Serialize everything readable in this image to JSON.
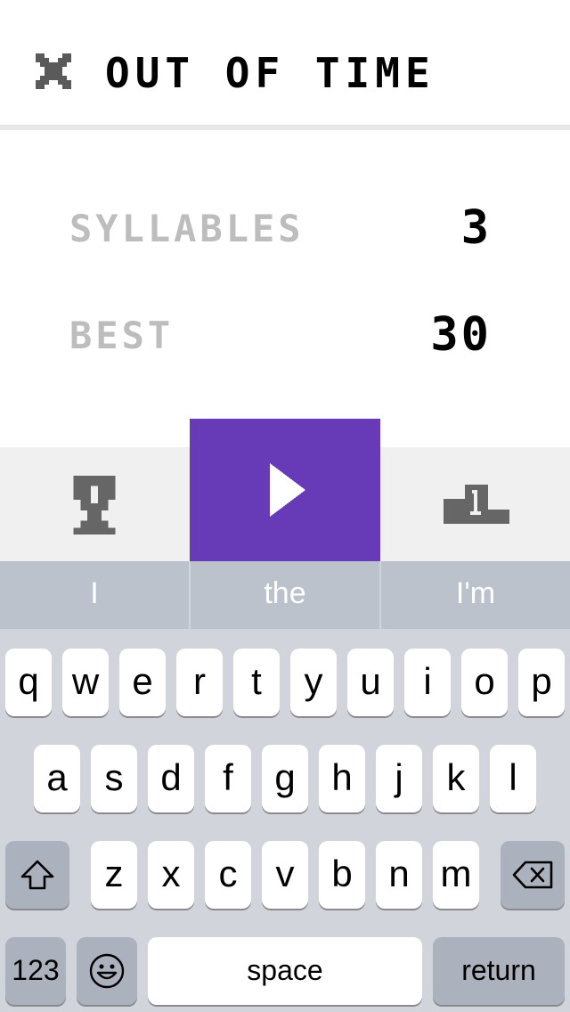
{
  "header": {
    "title": "OUT OF TIME"
  },
  "stats": {
    "syllables_label": "SYLLABLES",
    "syllables_value": "3",
    "best_label": "BEST",
    "best_value": "30"
  },
  "colors": {
    "accent": "#673ab7",
    "label_gray": "#bdbdbd",
    "icon_gray": "#666666"
  },
  "keyboard": {
    "suggestions": [
      "I",
      "the",
      "I'm"
    ],
    "row1": [
      "q",
      "w",
      "e",
      "r",
      "t",
      "y",
      "u",
      "i",
      "o",
      "p"
    ],
    "row2": [
      "a",
      "s",
      "d",
      "f",
      "g",
      "h",
      "j",
      "k",
      "l"
    ],
    "row3": [
      "z",
      "x",
      "c",
      "v",
      "b",
      "n",
      "m"
    ],
    "numbers_label": "123",
    "space_label": "space",
    "return_label": "return"
  }
}
